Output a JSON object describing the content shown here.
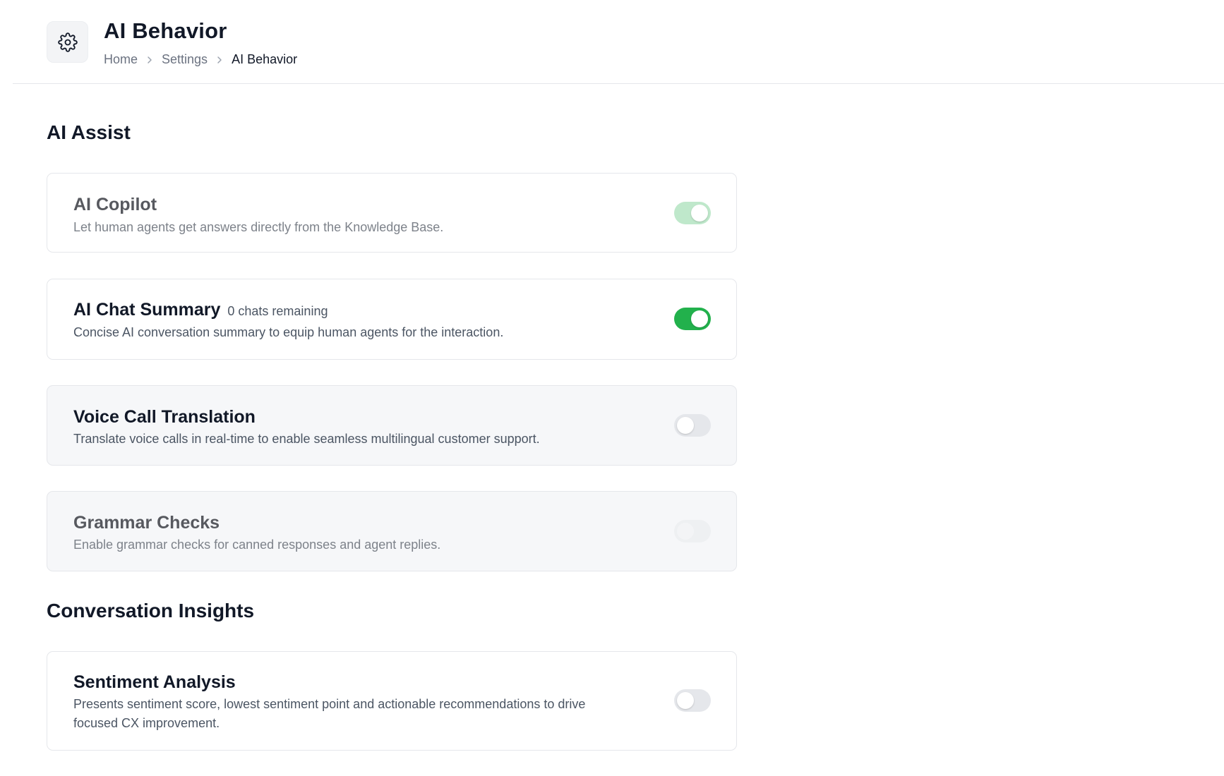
{
  "header": {
    "icon": "gear-icon",
    "title": "AI Behavior",
    "breadcrumb": [
      "Home",
      "Settings",
      "AI Behavior"
    ]
  },
  "sections": [
    {
      "title": "AI Assist",
      "items": [
        {
          "title": "AI Copilot",
          "description": "Let human agents get answers directly from the Knowledge Base.",
          "toggle": "on",
          "disabled": true
        },
        {
          "title": "AI Chat Summary",
          "badge": "0 chats remaining",
          "description": "Concise AI conversation summary to equip human agents for the interaction.",
          "toggle": "on",
          "disabled": false
        },
        {
          "title": "Voice Call Translation",
          "description": "Translate voice calls in real-time to enable seamless multilingual customer support.",
          "toggle": "off",
          "disabled": false
        },
        {
          "title": "Grammar Checks",
          "description": "Enable grammar checks for canned responses and agent replies.",
          "toggle": "off",
          "disabled": true
        }
      ]
    },
    {
      "title": "Conversation Insights",
      "items": [
        {
          "title": "Sentiment Analysis",
          "description": "Presents sentiment score, lowest sentiment point and actionable recommendations to drive focused CX improvement.",
          "toggle": "off",
          "disabled": false
        }
      ]
    }
  ],
  "colors": {
    "toggle_on": "#22b14c",
    "toggle_on_disabled": "#bfe8cb",
    "toggle_off": "#e5e7eb",
    "card_border": "#e5e7eb",
    "card_grey_bg": "#f6f7f9"
  }
}
